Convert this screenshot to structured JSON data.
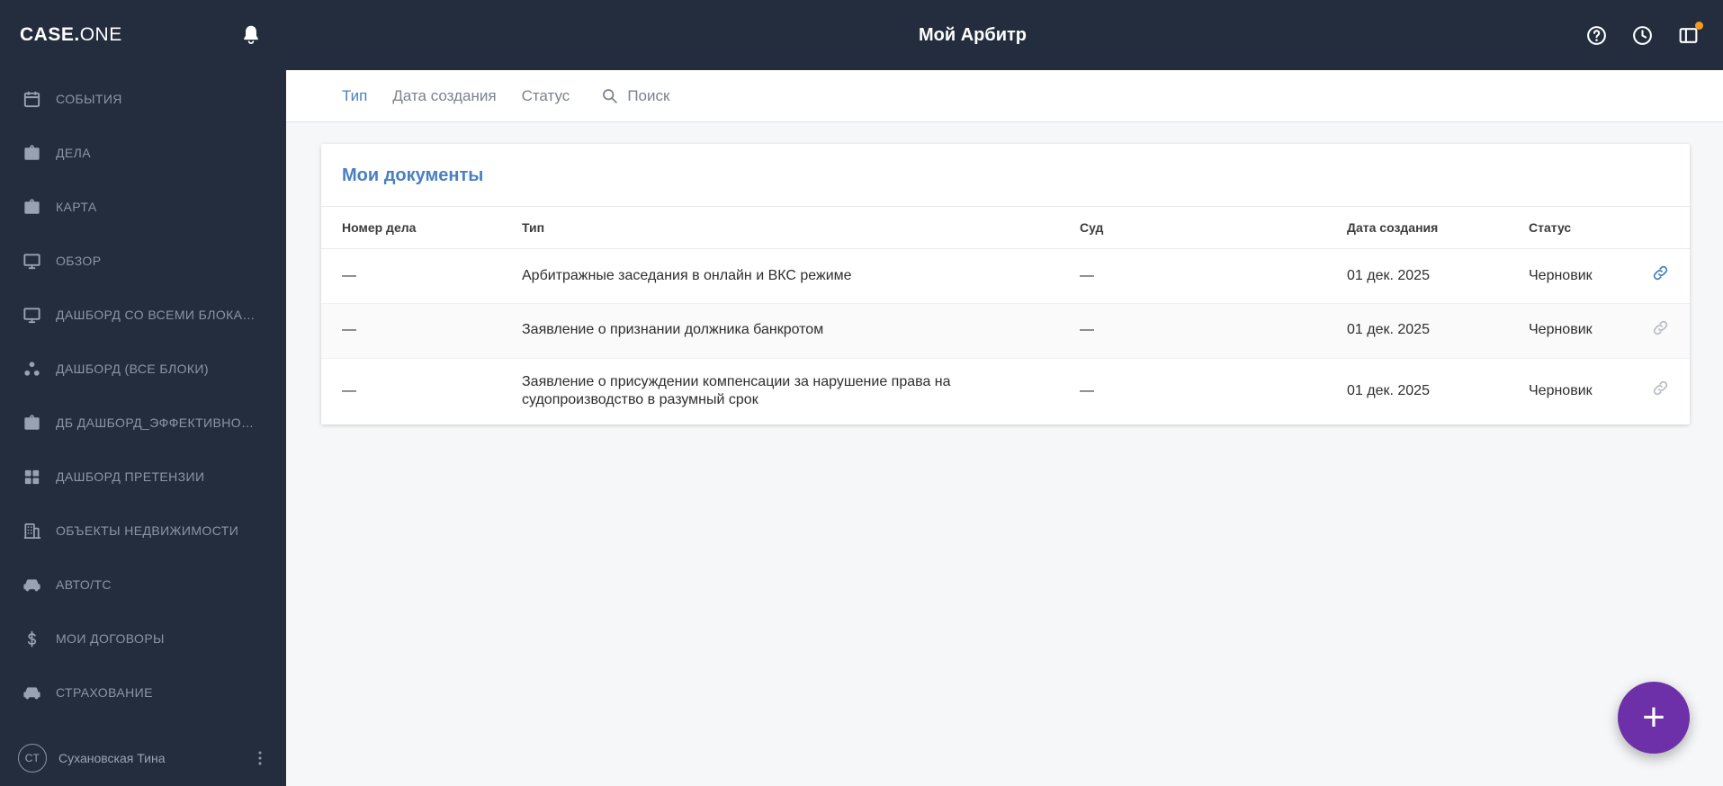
{
  "topbar": {
    "logo_primary": "CASE.",
    "logo_secondary": "ONE",
    "title": "Мой Арбитр"
  },
  "sidebar": {
    "items": [
      {
        "key": "events",
        "label": "СОБЫТИЯ",
        "icon": "events-icon"
      },
      {
        "key": "cases",
        "label": "ДЕЛА",
        "icon": "cases-icon"
      },
      {
        "key": "map",
        "label": "КАРТА",
        "icon": "map-icon"
      },
      {
        "key": "overview",
        "label": "ОБЗОР",
        "icon": "overview-icon"
      },
      {
        "key": "dashboard-all-blocks",
        "label": "ДАШБОРД СО ВСЕМИ БЛОКА…",
        "icon": "dashboard-monitor-icon"
      },
      {
        "key": "dashboard-vse-bloki",
        "label": "ДАШБОРД (ВСЕ БЛОКИ)",
        "icon": "dashboard-blocks-icon"
      },
      {
        "key": "db-dashboard-effective",
        "label": "ДБ ДАШБОРД_ЭФФЕКТИВНО…",
        "icon": "db-dashboard-icon"
      },
      {
        "key": "dashboard-claims",
        "label": "ДАШБОРД ПРЕТЕНЗИИ",
        "icon": "dashboard-claims-icon"
      },
      {
        "key": "real-estate",
        "label": "ОБЪЕКТЫ НЕДВИЖИМОСТИ",
        "icon": "real-estate-icon"
      },
      {
        "key": "auto",
        "label": "АВТО/ТС",
        "icon": "auto-icon"
      },
      {
        "key": "contracts",
        "label": "МОИ ДОГОВОРЫ",
        "icon": "contracts-icon"
      },
      {
        "key": "insurance",
        "label": "СТРАХОВАНИЕ",
        "icon": "insurance-icon"
      }
    ],
    "user": {
      "initials": "СТ",
      "name": "Сухановская Тина"
    }
  },
  "filters": {
    "type": "Тип",
    "created": "Дата создания",
    "status": "Статус",
    "search_placeholder": "Поиск"
  },
  "documents": {
    "title": "Мои документы",
    "columns": {
      "case_number": "Номер дела",
      "type": "Тип",
      "court": "Суд",
      "created": "Дата создания",
      "status": "Статус"
    },
    "rows": [
      {
        "case_number": "—",
        "type": "Арбитражные заседания в онлайн и ВКС режиме",
        "court": "—",
        "created": "01 дек. 2025",
        "status": "Черновик",
        "link_active": true
      },
      {
        "case_number": "—",
        "type": "Заявление о признании должника банкротом",
        "court": "—",
        "created": "01 дек. 2025",
        "status": "Черновик",
        "link_active": false
      },
      {
        "case_number": "—",
        "type": "Заявление о присуждении компенсации за нарушение права на судопроизводство в разумный срок",
        "court": "—",
        "created": "01 дек. 2025",
        "status": "Черновик",
        "link_active": false
      }
    ]
  },
  "fab": {
    "label": "+"
  },
  "colors": {
    "topbar_bg": "#232d3e",
    "accent_blue": "#4a7fc1",
    "fab_purple": "#6e30a9",
    "badge_orange": "#f59b22",
    "link_inactive": "#b9bec6"
  }
}
